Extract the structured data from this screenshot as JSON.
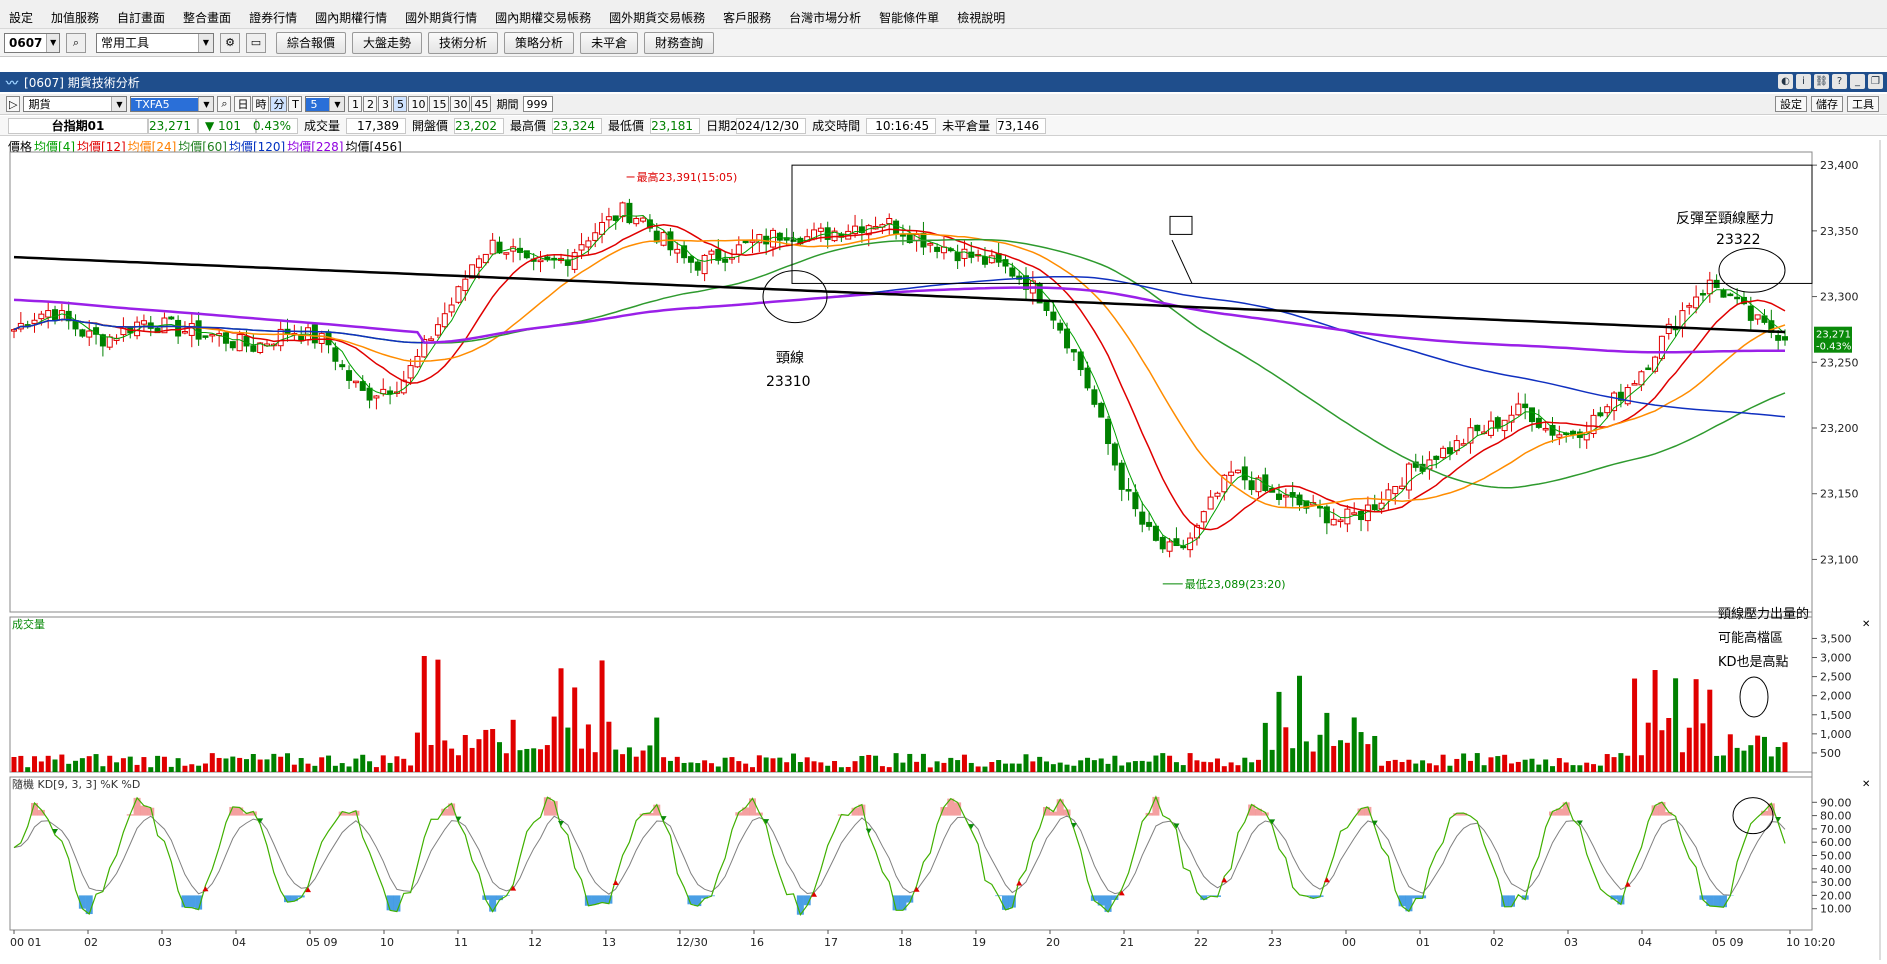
{
  "menu": [
    "設定",
    "加值服務",
    "自訂畫面",
    "整合畫面",
    "證券行情",
    "國內期權行情",
    "國外期貨行情",
    "國內期權交易帳務",
    "國外期貨交易帳務",
    "客戶服務",
    "台灣市場分析",
    "智能條件單",
    "檢視說明"
  ],
  "toolbar": {
    "code": "0607",
    "tools": "常用工具",
    "buttons": [
      "綜合報價",
      "大盤走勢",
      "技術分析",
      "策略分析",
      "未平倉",
      "財務查詢"
    ]
  },
  "window": {
    "title": "[0607] 期貨技術分析"
  },
  "controls": {
    "market": "期貨",
    "symbol": "TXFA5",
    "period_tabs": [
      "日",
      "時",
      "分",
      "T"
    ],
    "minute_value": "5",
    "minute_buttons": [
      "1",
      "2",
      "3",
      "5",
      "10",
      "15",
      "30",
      "45"
    ],
    "period_label": "期間",
    "period_value": "999",
    "right_buttons": [
      "設定",
      "儲存",
      "工具"
    ]
  },
  "quote": {
    "name": "台指期01",
    "price": "23,271",
    "change": "▼ 101",
    "change_pct": "0.43%",
    "volume_label": "成交量",
    "volume": "17,389",
    "open_label": "開盤價",
    "open": "23,202",
    "high_label": "最高價",
    "high": "23,324",
    "low_label": "最低價",
    "low": "23,181",
    "date_label": "日期",
    "date": "2024/12/30",
    "time_label": "成交時間",
    "time": "10:16:45",
    "oi_label": "未平倉量",
    "oi": "73,146"
  },
  "legend": [
    {
      "text": "價格",
      "color": "#000000"
    },
    {
      "text": "均價[4]",
      "color": "#00a000"
    },
    {
      "text": "均價[12]",
      "color": "#e00000"
    },
    {
      "text": "均價[24]",
      "color": "#ff8000"
    },
    {
      "text": "均價[60]",
      "color": "#208020"
    },
    {
      "text": "均價[120]",
      "color": "#0030c0"
    },
    {
      "text": "均價[228]",
      "color": "#9000e0"
    },
    {
      "text": "均價[456]",
      "color": "#000000"
    }
  ],
  "colors": {
    "up": "#e00000",
    "down": "#008000",
    "ma4": "#00a000",
    "ma12": "#e00000",
    "ma24": "#ff8c00",
    "ma60": "#2e9a2e",
    "ma120": "#1030c0",
    "ma228": "#9a20e8",
    "ma456": "#000000",
    "k": "#40b000",
    "d": "#808080"
  },
  "annotations": {
    "high_marker": "最高23,391(15:05)",
    "low_marker": "最低23,089(23:20)",
    "neckline_label": "頸線",
    "neckline_value": "23310",
    "rebound_label": "反彈至頸線壓力",
    "rebound_value": "23322",
    "note_lines": [
      "頸線壓力出量的",
      "可能高檔區",
      "KD也是高點"
    ]
  },
  "last_price_tag": {
    "price": "23,271",
    "pct": "-0.43%"
  },
  "volume_title": "成交量",
  "kd_title": "隨機 KD[9, 3, 3] %K %D",
  "chart_data": [
    {
      "type": "candlestick",
      "title": "",
      "y_ticks": [
        23100,
        23150,
        23200,
        23250,
        23300,
        23350,
        23400
      ],
      "ylim": [
        23060,
        23410
      ],
      "x_ticks": [
        "00 01",
        "02",
        "03",
        "04",
        "05 09",
        "10",
        "11",
        "12",
        "13",
        "12/30",
        "16",
        "17",
        "18",
        "19",
        "20",
        "21",
        "22",
        "23",
        "00",
        "01",
        "02",
        "03",
        "04",
        "05 09",
        "10 10:20"
      ],
      "high": 23391,
      "low": 23089,
      "last": 23271,
      "close_path": [
        23275,
        23285,
        23290,
        23280,
        23270,
        23268,
        23275,
        23282,
        23278,
        23275,
        23272,
        23270,
        23265,
        23262,
        23268,
        23275,
        23270,
        23265,
        23240,
        23225,
        23230,
        23235,
        23255,
        23280,
        23300,
        23330,
        23340,
        23335,
        23320,
        23325,
        23330,
        23345,
        23355,
        23365,
        23360,
        23345,
        23330,
        23325,
        23330,
        23335,
        23340,
        23345,
        23350,
        23345,
        23348,
        23352,
        23355,
        23358,
        23352,
        23345,
        23340,
        23335,
        23330,
        23325,
        23320,
        23310,
        23295,
        23270,
        23240,
        23200,
        23160,
        23130,
        23110,
        23105,
        23120,
        23145,
        23165,
        23160,
        23150,
        23145,
        23140,
        23135,
        23130,
        23135,
        23145,
        23160,
        23170,
        23180,
        23185,
        23195,
        23200,
        23210,
        23215,
        23200,
        23195,
        23200,
        23210,
        23225,
        23240,
        23260,
        23280,
        23300,
        23310,
        23300,
        23285,
        23275,
        23271
      ]
    },
    {
      "type": "bar",
      "title": "成交量",
      "y_ticks": [
        500,
        1000,
        1500,
        2000,
        2500,
        3000,
        3500
      ],
      "ylim": [
        0,
        3800
      ],
      "peaks": [
        {
          "session": "05 09",
          "value": 3300
        },
        {
          "session": "10",
          "value": 2200
        },
        {
          "session": "22",
          "value": 2900
        },
        {
          "session": "22",
          "value": 2600
        },
        {
          "session": "05 09",
          "value": 2100
        },
        {
          "session": "10 10:20",
          "value": 1900
        }
      ]
    },
    {
      "type": "line",
      "title": "隨機 KD[9, 3, 3] %K %D",
      "series": [
        {
          "name": "%K"
        },
        {
          "name": "%D"
        }
      ],
      "y_ticks": [
        10,
        20,
        30,
        40,
        50,
        60,
        70,
        80,
        90
      ],
      "ylim": [
        0,
        100
      ],
      "overbought": 80,
      "oversold": 20
    }
  ]
}
